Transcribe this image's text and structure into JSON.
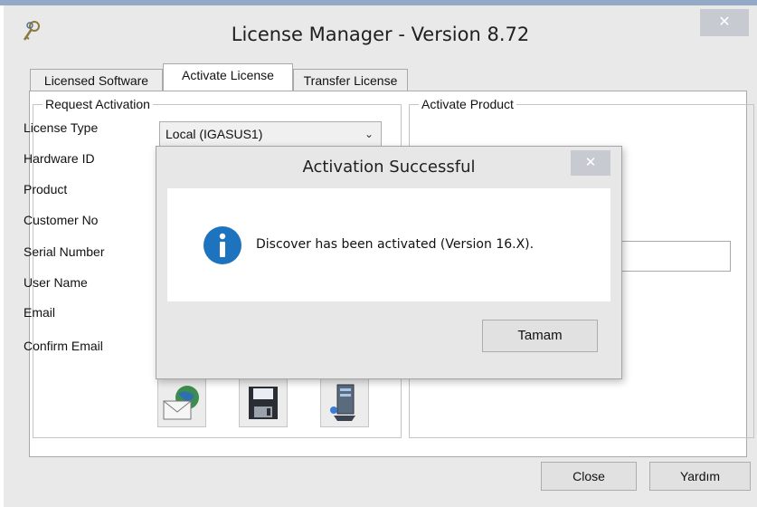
{
  "window": {
    "title": "License Manager - Version 8.72",
    "close_glyph": "✕",
    "icon": "keys-icon"
  },
  "tabs": [
    {
      "label": "Licensed Software"
    },
    {
      "label": "Activate License"
    },
    {
      "label": "Transfer License"
    }
  ],
  "request_activation": {
    "title": "Request Activation",
    "fields": [
      {
        "label": "License Type"
      },
      {
        "label": "Hardware ID"
      },
      {
        "label": "Product"
      },
      {
        "label": "Customer No"
      },
      {
        "label": "Serial Number"
      },
      {
        "label": "User Name"
      },
      {
        "label": "Email"
      },
      {
        "label": "Confirm Email"
      }
    ],
    "license_type_value": "Local (IGASUS1)",
    "action_icons": [
      "email-web-icon",
      "save-floppy-icon",
      "computer-network-icon"
    ]
  },
  "activate_product": {
    "title": "Activate Product"
  },
  "footer": {
    "close_label": "Close",
    "help_label": "Yardım"
  },
  "dialog": {
    "title": "Activation Successful",
    "close_glyph": "✕",
    "message": "Discover has been activated (Version 16.X).",
    "ok_label": "Tamam",
    "icon": "info-icon",
    "accent": "#1e73be"
  }
}
